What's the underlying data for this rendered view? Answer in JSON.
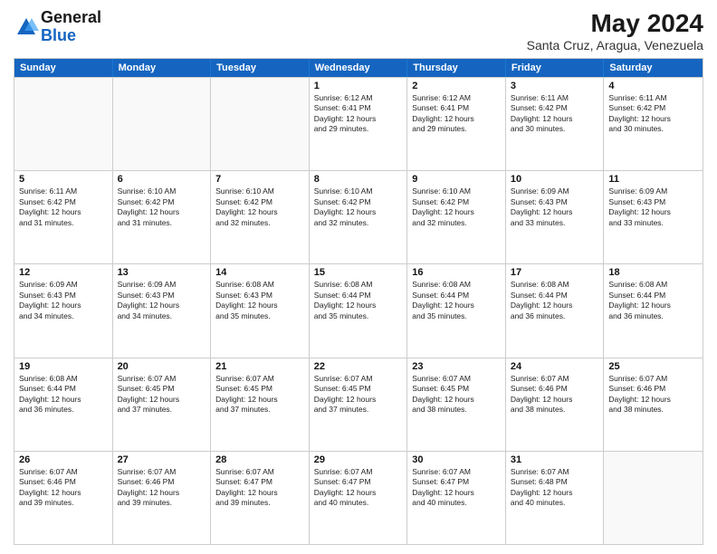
{
  "logo": {
    "line1": "General",
    "line2": "Blue"
  },
  "title": {
    "month_year": "May 2024",
    "location": "Santa Cruz, Aragua, Venezuela"
  },
  "weekdays": [
    "Sunday",
    "Monday",
    "Tuesday",
    "Wednesday",
    "Thursday",
    "Friday",
    "Saturday"
  ],
  "rows": [
    [
      {
        "day": "",
        "text": "",
        "empty": true
      },
      {
        "day": "",
        "text": "",
        "empty": true
      },
      {
        "day": "",
        "text": "",
        "empty": true
      },
      {
        "day": "1",
        "text": "Sunrise: 6:12 AM\nSunset: 6:41 PM\nDaylight: 12 hours\nand 29 minutes."
      },
      {
        "day": "2",
        "text": "Sunrise: 6:12 AM\nSunset: 6:41 PM\nDaylight: 12 hours\nand 29 minutes."
      },
      {
        "day": "3",
        "text": "Sunrise: 6:11 AM\nSunset: 6:42 PM\nDaylight: 12 hours\nand 30 minutes."
      },
      {
        "day": "4",
        "text": "Sunrise: 6:11 AM\nSunset: 6:42 PM\nDaylight: 12 hours\nand 30 minutes."
      }
    ],
    [
      {
        "day": "5",
        "text": "Sunrise: 6:11 AM\nSunset: 6:42 PM\nDaylight: 12 hours\nand 31 minutes."
      },
      {
        "day": "6",
        "text": "Sunrise: 6:10 AM\nSunset: 6:42 PM\nDaylight: 12 hours\nand 31 minutes."
      },
      {
        "day": "7",
        "text": "Sunrise: 6:10 AM\nSunset: 6:42 PM\nDaylight: 12 hours\nand 32 minutes."
      },
      {
        "day": "8",
        "text": "Sunrise: 6:10 AM\nSunset: 6:42 PM\nDaylight: 12 hours\nand 32 minutes."
      },
      {
        "day": "9",
        "text": "Sunrise: 6:10 AM\nSunset: 6:42 PM\nDaylight: 12 hours\nand 32 minutes."
      },
      {
        "day": "10",
        "text": "Sunrise: 6:09 AM\nSunset: 6:43 PM\nDaylight: 12 hours\nand 33 minutes."
      },
      {
        "day": "11",
        "text": "Sunrise: 6:09 AM\nSunset: 6:43 PM\nDaylight: 12 hours\nand 33 minutes."
      }
    ],
    [
      {
        "day": "12",
        "text": "Sunrise: 6:09 AM\nSunset: 6:43 PM\nDaylight: 12 hours\nand 34 minutes."
      },
      {
        "day": "13",
        "text": "Sunrise: 6:09 AM\nSunset: 6:43 PM\nDaylight: 12 hours\nand 34 minutes."
      },
      {
        "day": "14",
        "text": "Sunrise: 6:08 AM\nSunset: 6:43 PM\nDaylight: 12 hours\nand 35 minutes."
      },
      {
        "day": "15",
        "text": "Sunrise: 6:08 AM\nSunset: 6:44 PM\nDaylight: 12 hours\nand 35 minutes."
      },
      {
        "day": "16",
        "text": "Sunrise: 6:08 AM\nSunset: 6:44 PM\nDaylight: 12 hours\nand 35 minutes."
      },
      {
        "day": "17",
        "text": "Sunrise: 6:08 AM\nSunset: 6:44 PM\nDaylight: 12 hours\nand 36 minutes."
      },
      {
        "day": "18",
        "text": "Sunrise: 6:08 AM\nSunset: 6:44 PM\nDaylight: 12 hours\nand 36 minutes."
      }
    ],
    [
      {
        "day": "19",
        "text": "Sunrise: 6:08 AM\nSunset: 6:44 PM\nDaylight: 12 hours\nand 36 minutes."
      },
      {
        "day": "20",
        "text": "Sunrise: 6:07 AM\nSunset: 6:45 PM\nDaylight: 12 hours\nand 37 minutes."
      },
      {
        "day": "21",
        "text": "Sunrise: 6:07 AM\nSunset: 6:45 PM\nDaylight: 12 hours\nand 37 minutes."
      },
      {
        "day": "22",
        "text": "Sunrise: 6:07 AM\nSunset: 6:45 PM\nDaylight: 12 hours\nand 37 minutes."
      },
      {
        "day": "23",
        "text": "Sunrise: 6:07 AM\nSunset: 6:45 PM\nDaylight: 12 hours\nand 38 minutes."
      },
      {
        "day": "24",
        "text": "Sunrise: 6:07 AM\nSunset: 6:46 PM\nDaylight: 12 hours\nand 38 minutes."
      },
      {
        "day": "25",
        "text": "Sunrise: 6:07 AM\nSunset: 6:46 PM\nDaylight: 12 hours\nand 38 minutes."
      }
    ],
    [
      {
        "day": "26",
        "text": "Sunrise: 6:07 AM\nSunset: 6:46 PM\nDaylight: 12 hours\nand 39 minutes."
      },
      {
        "day": "27",
        "text": "Sunrise: 6:07 AM\nSunset: 6:46 PM\nDaylight: 12 hours\nand 39 minutes."
      },
      {
        "day": "28",
        "text": "Sunrise: 6:07 AM\nSunset: 6:47 PM\nDaylight: 12 hours\nand 39 minutes."
      },
      {
        "day": "29",
        "text": "Sunrise: 6:07 AM\nSunset: 6:47 PM\nDaylight: 12 hours\nand 40 minutes."
      },
      {
        "day": "30",
        "text": "Sunrise: 6:07 AM\nSunset: 6:47 PM\nDaylight: 12 hours\nand 40 minutes."
      },
      {
        "day": "31",
        "text": "Sunrise: 6:07 AM\nSunset: 6:48 PM\nDaylight: 12 hours\nand 40 minutes."
      },
      {
        "day": "",
        "text": "",
        "empty": true
      }
    ]
  ]
}
